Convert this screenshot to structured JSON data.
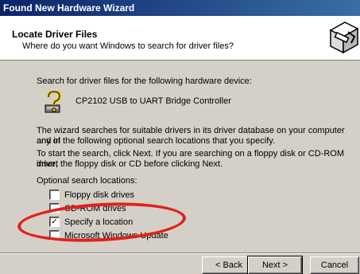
{
  "window": {
    "title": "Found New Hardware Wizard"
  },
  "header": {
    "title": "Locate Driver Files",
    "subtitle": "Where do you want Windows to search for driver files?"
  },
  "body": {
    "search_intro": "Search for driver files for the following hardware device:",
    "device_name": "CP2102 USB to UART Bridge Controller",
    "paragraph1_line1": "The wizard searches for suitable drivers in its driver database on your computer and in",
    "paragraph1_line2": "any of the following optional search locations that you specify.",
    "paragraph2_line1": "To start the search, click Next. If you are searching on a floppy disk or CD-ROM drive,",
    "paragraph2_line2": "insert the floppy disk or CD before clicking Next.",
    "optional_locations_label": "Optional search locations:"
  },
  "options": [
    {
      "label": "Floppy disk drives",
      "checked": false
    },
    {
      "label": "CD-ROM drives",
      "checked": false
    },
    {
      "label": "Specify a location",
      "checked": true
    },
    {
      "label": "Microsoft Windows Update",
      "checked": false
    }
  ],
  "buttons": {
    "back": "< Back",
    "next": "Next >",
    "cancel": "Cancel"
  },
  "icons": {
    "device": "question-mark-device-icon",
    "header": "hardware-wizard-icon"
  },
  "colors": {
    "titlebar_start": "#0a246a",
    "titlebar_end": "#3a6ea5",
    "dialog_bg": "#d4d0c8",
    "highlight_annotation": "#e2201c"
  }
}
